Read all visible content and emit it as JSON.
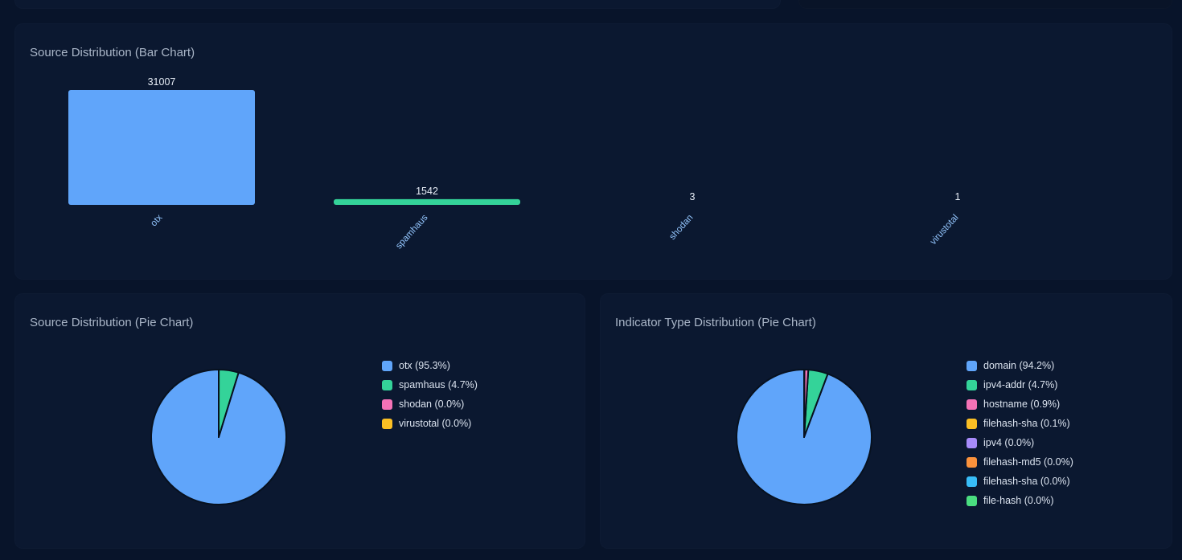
{
  "bar_panel": {
    "title": "Source Distribution (Bar Chart)"
  },
  "source_pie_panel": {
    "title": "Source Distribution (Pie Chart)"
  },
  "indicator_pie_panel": {
    "title": "Indicator Type Distribution (Pie Chart)"
  },
  "chart_data": [
    {
      "type": "bar",
      "title": "Source Distribution (Bar Chart)",
      "categories": [
        "otx",
        "spamhaus",
        "shodan",
        "virustotal"
      ],
      "values": [
        31007,
        1542,
        3,
        1
      ],
      "value_labels": [
        "31007",
        "1542",
        "3",
        "1"
      ],
      "colors": [
        "#60a5fa",
        "#34d399",
        "#f472b6",
        "#fbbf24"
      ],
      "grid": false
    },
    {
      "type": "pie",
      "title": "Source Distribution (Pie Chart)",
      "labels": [
        "otx",
        "spamhaus",
        "shodan",
        "virustotal"
      ],
      "values": [
        31007,
        1542,
        3,
        1
      ],
      "legend_labels": [
        "otx (95.3%)",
        "spamhaus (4.7%)",
        "shodan (0.0%)",
        "virustotal (0.0%)"
      ],
      "colors": [
        "#60a5fa",
        "#34d399",
        "#f472b6",
        "#fbbf24"
      ],
      "legend": "right"
    },
    {
      "type": "pie",
      "title": "Indicator Type Distribution (Pie Chart)",
      "labels": [
        "domain",
        "ipv4-addr",
        "hostname",
        "filehash-sha",
        "ipv4",
        "filehash-md5",
        "filehash-sha",
        "file-hash"
      ],
      "values": [
        94.2,
        4.7,
        0.9,
        0.1,
        0.0,
        0.0,
        0.0,
        0.0
      ],
      "legend_labels": [
        "domain (94.2%)",
        "ipv4-addr (4.7%)",
        "hostname (0.9%)",
        "filehash-sha (0.1%)",
        "ipv4 (0.0%)",
        "filehash-md5 (0.0%)",
        "filehash-sha (0.0%)",
        "file-hash (0.0%)"
      ],
      "colors": [
        "#60a5fa",
        "#34d399",
        "#f472b6",
        "#fbbf24",
        "#a78bfa",
        "#fb923c",
        "#38bdf8",
        "#4ade80"
      ],
      "legend": "right"
    }
  ]
}
